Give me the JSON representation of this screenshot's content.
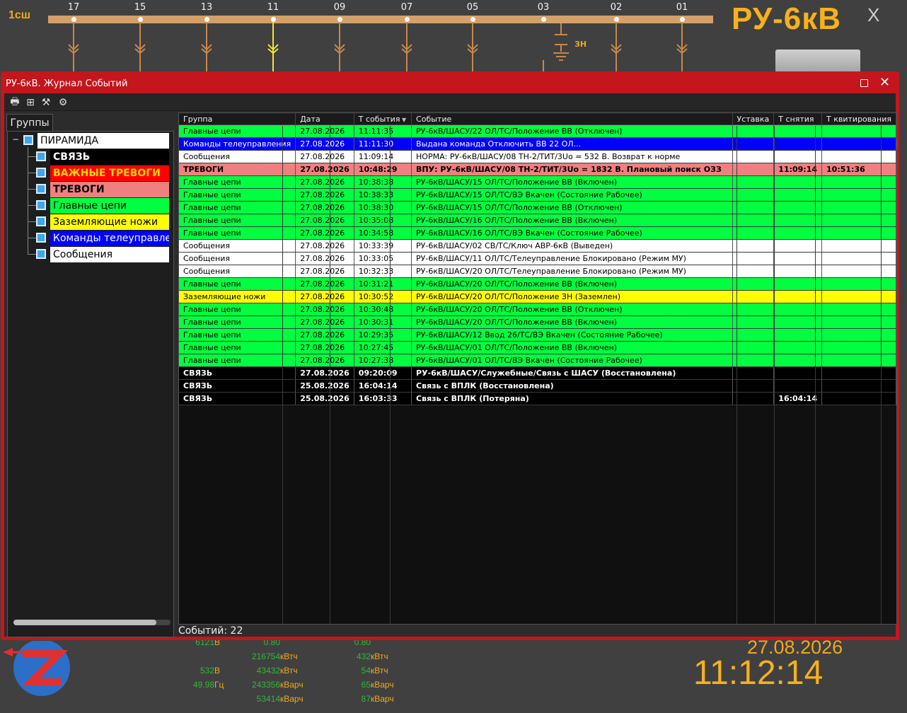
{
  "section_label": "1сш",
  "big_title": "РУ-6кВ",
  "close_label": "X",
  "feeders": [
    "17",
    "15",
    "13",
    "11",
    "09",
    "07",
    "05",
    "03",
    "02",
    "01"
  ],
  "zn_label": "ЗН",
  "clock": {
    "date": "27.08.2026",
    "time": "11:12:14"
  },
  "measurements": [
    {
      "value": "6121",
      "unit": "В"
    },
    {
      "value": "0.80",
      "unit": ""
    },
    {
      "value": "0.80",
      "unit": ""
    },
    {
      "value": "",
      "unit": ""
    },
    {
      "value": "216754",
      "unit": "кВтч"
    },
    {
      "value": "432",
      "unit": "кВтч"
    },
    {
      "value": "532",
      "unit": "В"
    },
    {
      "value": "43432",
      "unit": "кВтч"
    },
    {
      "value": "54",
      "unit": "кВтч"
    },
    {
      "value": "49.98",
      "unit": "Гц"
    },
    {
      "value": "243356",
      "unit": "кВарч"
    },
    {
      "value": "65",
      "unit": "кВарч"
    },
    {
      "value": "",
      "unit": ""
    },
    {
      "value": "53414",
      "unit": "кВарч"
    },
    {
      "value": "87",
      "unit": "кВарч"
    }
  ],
  "window": {
    "title": "РУ-6кВ. Журнал Событий",
    "groups_tab": "Группы",
    "event_count": "Событий: 22",
    "tree": {
      "root": "ПИРАМИДА",
      "items": [
        {
          "label": "СВЯЗЬ",
          "bg": "#000000",
          "fg": "#ffffff",
          "bold": true
        },
        {
          "label": "ВАЖНЫЕ ТРЕВОГИ",
          "bg": "#ff0000",
          "fg": "#ffd800",
          "bold": true
        },
        {
          "label": "ТРЕВОГИ",
          "bg": "#f08080",
          "fg": "#000000",
          "bold": true
        },
        {
          "label": "Главные цепи",
          "bg": "#00ff40",
          "fg": "#000000",
          "bold": false
        },
        {
          "label": "Заземляющие ножи",
          "bg": "#ffff00",
          "fg": "#000000",
          "bold": false
        },
        {
          "label": "Команды телеуправлен",
          "bg": "#0000ff",
          "fg": "#ffffff",
          "bold": false
        },
        {
          "label": "Сообщения",
          "bg": "#ffffff",
          "fg": "#000000",
          "bold": false
        }
      ]
    },
    "columns": [
      "Группа",
      "Дата",
      "Т события",
      "Событие",
      "Уставка",
      "Т снятия",
      "Т квитирования"
    ],
    "rows": [
      {
        "g": "Главные цепи",
        "d": "27.08.2026",
        "t": "11:11:35",
        "e": "РУ-6кВ/ШАСУ/22 ОЛ/ТС/Положение ВВ (Отключен)",
        "s": "",
        "ts": "",
        "tk": "",
        "bg": "#00ff40",
        "fg": "#000000",
        "b": false
      },
      {
        "g": "Команды телеуправления",
        "d": "27.08.2026",
        "t": "11:11:30",
        "e": "Выдана команда Отключить ВВ 22 ОЛ...",
        "s": "",
        "ts": "",
        "tk": "",
        "bg": "#0000ff",
        "fg": "#ffffff",
        "b": false
      },
      {
        "g": "Сообщения",
        "d": "27.08.2026",
        "t": "11:09:14",
        "e": "НОРМА: РУ-6кВ/ШАСУ/08 ТН-2/ТИТ/3Uo = 532 В. Возврат к норме",
        "s": "",
        "ts": "",
        "tk": "",
        "bg": "#ffffff",
        "fg": "#000000",
        "b": false
      },
      {
        "g": "ТРЕВОГИ",
        "d": "27.08.2026",
        "t": "10:48:29",
        "e": "ВПУ: РУ-6кВ/ШАСУ/08 ТН-2/ТИТ/3Uo = 1832 В. Плановый поиск ОЗЗ",
        "s": "",
        "ts": "11:09:14",
        "tk": "10:51:36",
        "bg": "#f08080",
        "fg": "#000000",
        "b": true
      },
      {
        "g": "Главные цепи",
        "d": "27.08.2026",
        "t": "10:38:38",
        "e": "РУ-6кВ/ШАСУ/15 ОЛ/ТС/Положение ВВ (Включен)",
        "s": "",
        "ts": "",
        "tk": "",
        "bg": "#00ff40",
        "fg": "#000000",
        "b": false
      },
      {
        "g": "Главные цепи",
        "d": "27.08.2026",
        "t": "10:38:33",
        "e": "РУ-6кВ/ШАСУ/15 ОЛ/ТС/ВЭ Вкачен (Состояние Рабочее)",
        "s": "",
        "ts": "",
        "tk": "",
        "bg": "#00ff40",
        "fg": "#000000",
        "b": false
      },
      {
        "g": "Главные цепи",
        "d": "27.08.2026",
        "t": "10:38:30",
        "e": "РУ-6кВ/ШАСУ/15 ОЛ/ТС/Положение ВВ (Отключен)",
        "s": "",
        "ts": "",
        "tk": "",
        "bg": "#00ff40",
        "fg": "#000000",
        "b": false
      },
      {
        "g": "Главные цепи",
        "d": "27.08.2026",
        "t": "10:35:08",
        "e": "РУ-6кВ/ШАСУ/16 ОЛ/ТС/Положение ВВ (Включен)",
        "s": "",
        "ts": "",
        "tk": "",
        "bg": "#00ff40",
        "fg": "#000000",
        "b": false
      },
      {
        "g": "Главные цепи",
        "d": "27.08.2026",
        "t": "10:34:58",
        "e": "РУ-6кВ/ШАСУ/16 ОЛ/ТС/ВЭ Вкачен (Состояние Рабочее)",
        "s": "",
        "ts": "",
        "tk": "",
        "bg": "#00ff40",
        "fg": "#000000",
        "b": false
      },
      {
        "g": "Сообщения",
        "d": "27.08.2026",
        "t": "10:33:39",
        "e": "РУ-6кВ/ШАСУ/02 СВ/ТС/Ключ АВР-6кВ (Выведен)",
        "s": "",
        "ts": "",
        "tk": "",
        "bg": "#ffffff",
        "fg": "#000000",
        "b": false
      },
      {
        "g": "Сообщения",
        "d": "27.08.2026",
        "t": "10:33:05",
        "e": "РУ-6кВ/ШАСУ/11 ОЛ/ТС/Телеуправление Блокировано (Режим МУ)",
        "s": "",
        "ts": "",
        "tk": "",
        "bg": "#ffffff",
        "fg": "#000000",
        "b": false
      },
      {
        "g": "Сообщения",
        "d": "27.08.2026",
        "t": "10:32:33",
        "e": "РУ-6кВ/ШАСУ/20 ОЛ/ТС/Телеуправление Блокировано (Режим МУ)",
        "s": "",
        "ts": "",
        "tk": "",
        "bg": "#ffffff",
        "fg": "#000000",
        "b": false
      },
      {
        "g": "Главные цепи",
        "d": "27.08.2026",
        "t": "10:31:21",
        "e": "РУ-6кВ/ШАСУ/20 ОЛ/ТС/Положение ВВ (Включен)",
        "s": "",
        "ts": "",
        "tk": "",
        "bg": "#00ff40",
        "fg": "#000000",
        "b": false
      },
      {
        "g": "Заземляющие ножи",
        "d": "27.08.2026",
        "t": "10:30:52",
        "e": "РУ-6кВ/ШАСУ/20 ОЛ/ТС/Положение ЗН (Заземлен)",
        "s": "",
        "ts": "",
        "tk": "",
        "bg": "#ffff00",
        "fg": "#000000",
        "b": false
      },
      {
        "g": "Главные цепи",
        "d": "27.08.2026",
        "t": "10:30:48",
        "e": "РУ-6кВ/ШАСУ/20 ОЛ/ТС/Положение ВВ (Отключен)",
        "s": "",
        "ts": "",
        "tk": "",
        "bg": "#00ff40",
        "fg": "#000000",
        "b": false
      },
      {
        "g": "Главные цепи",
        "d": "27.08.2026",
        "t": "10:30:31",
        "e": "РУ-6кВ/ШАСУ/20 ОЛ/ТС/Положение ВВ (Включен)",
        "s": "",
        "ts": "",
        "tk": "",
        "bg": "#00ff40",
        "fg": "#000000",
        "b": false
      },
      {
        "g": "Главные цепи",
        "d": "27.08.2026",
        "t": "10:29:35",
        "e": "РУ-6кВ/ШАСУ/12 Ввод 26/ТС/ВЭ Вкачен (Состояние Рабочее)",
        "s": "",
        "ts": "",
        "tk": "",
        "bg": "#00ff40",
        "fg": "#000000",
        "b": false
      },
      {
        "g": "Главные цепи",
        "d": "27.08.2026",
        "t": "10:27:45",
        "e": "РУ-6кВ/ШАСУ/01 ОЛ/ТС/Положение ВВ (Включен)",
        "s": "",
        "ts": "",
        "tk": "",
        "bg": "#00ff40",
        "fg": "#000000",
        "b": false
      },
      {
        "g": "Главные цепи",
        "d": "27.08.2026",
        "t": "10:27:38",
        "e": "РУ-6кВ/ШАСУ/01 ОЛ/ТС/ВЭ Вкачен (Состояние Рабочее)",
        "s": "",
        "ts": "",
        "tk": "",
        "bg": "#00ff40",
        "fg": "#000000",
        "b": false
      },
      {
        "g": "СВЯЗЬ",
        "d": "27.08.2026",
        "t": "09:20:09",
        "e": "РУ-6кВ/ШАСУ/Служебные/Связь с ШАСУ (Восстановлена)",
        "s": "",
        "ts": "",
        "tk": "",
        "bg": "#000000",
        "fg": "#ffffff",
        "b": true
      },
      {
        "g": "СВЯЗЬ",
        "d": "25.08.2026",
        "t": "16:04:14",
        "e": "Связь с ВПЛК (Восстановлена)",
        "s": "",
        "ts": "",
        "tk": "",
        "bg": "#000000",
        "fg": "#ffffff",
        "b": true
      },
      {
        "g": "СВЯЗЬ",
        "d": "25.08.2026",
        "t": "16:03:33",
        "e": "Связь с ВПЛК (Потеряна)",
        "s": "",
        "ts": "16:04:14",
        "tk": "",
        "bg": "#000000",
        "fg": "#ffffff",
        "b": true
      }
    ]
  }
}
